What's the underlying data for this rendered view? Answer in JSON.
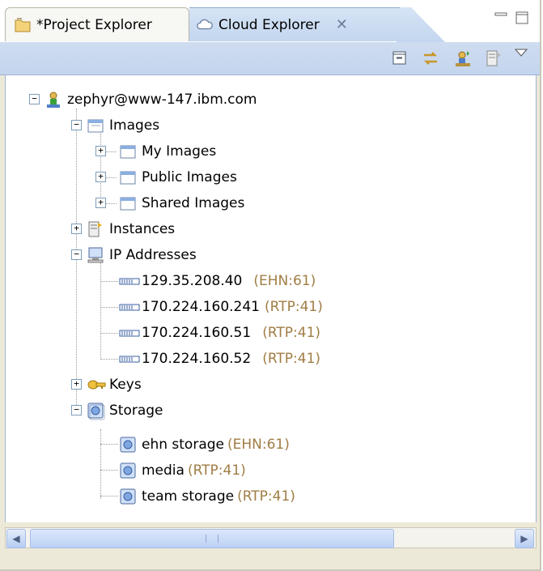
{
  "tabs": {
    "project_explorer": "*Project Explorer",
    "cloud_explorer": "Cloud Explorer",
    "close_glyph": "✕"
  },
  "tree": {
    "root": {
      "label": "zephyr@www-147.ibm.com"
    },
    "images": {
      "label": "Images",
      "children": [
        "My Images",
        "Public Images",
        "Shared Images"
      ]
    },
    "instances": {
      "label": "Instances"
    },
    "ip_addresses": {
      "label": "IP Addresses",
      "children": [
        {
          "address": "129.35.208.40",
          "region": "(EHN:61)"
        },
        {
          "address": "170.224.160.241",
          "region": "(RTP:41)"
        },
        {
          "address": "170.224.160.51",
          "region": "(RTP:41)"
        },
        {
          "address": "170.224.160.52",
          "region": "(RTP:41)"
        }
      ]
    },
    "keys": {
      "label": "Keys"
    },
    "storage": {
      "label": "Storage",
      "children": [
        {
          "name": "ehn storage",
          "region": "(EHN:61)"
        },
        {
          "name": "media",
          "region": "(RTP:41)"
        },
        {
          "name": "team storage",
          "region": "(RTP:41)"
        }
      ]
    }
  },
  "colors": {
    "region_text": "#a07d44",
    "toolbar_bg": "#c3d5ee"
  }
}
